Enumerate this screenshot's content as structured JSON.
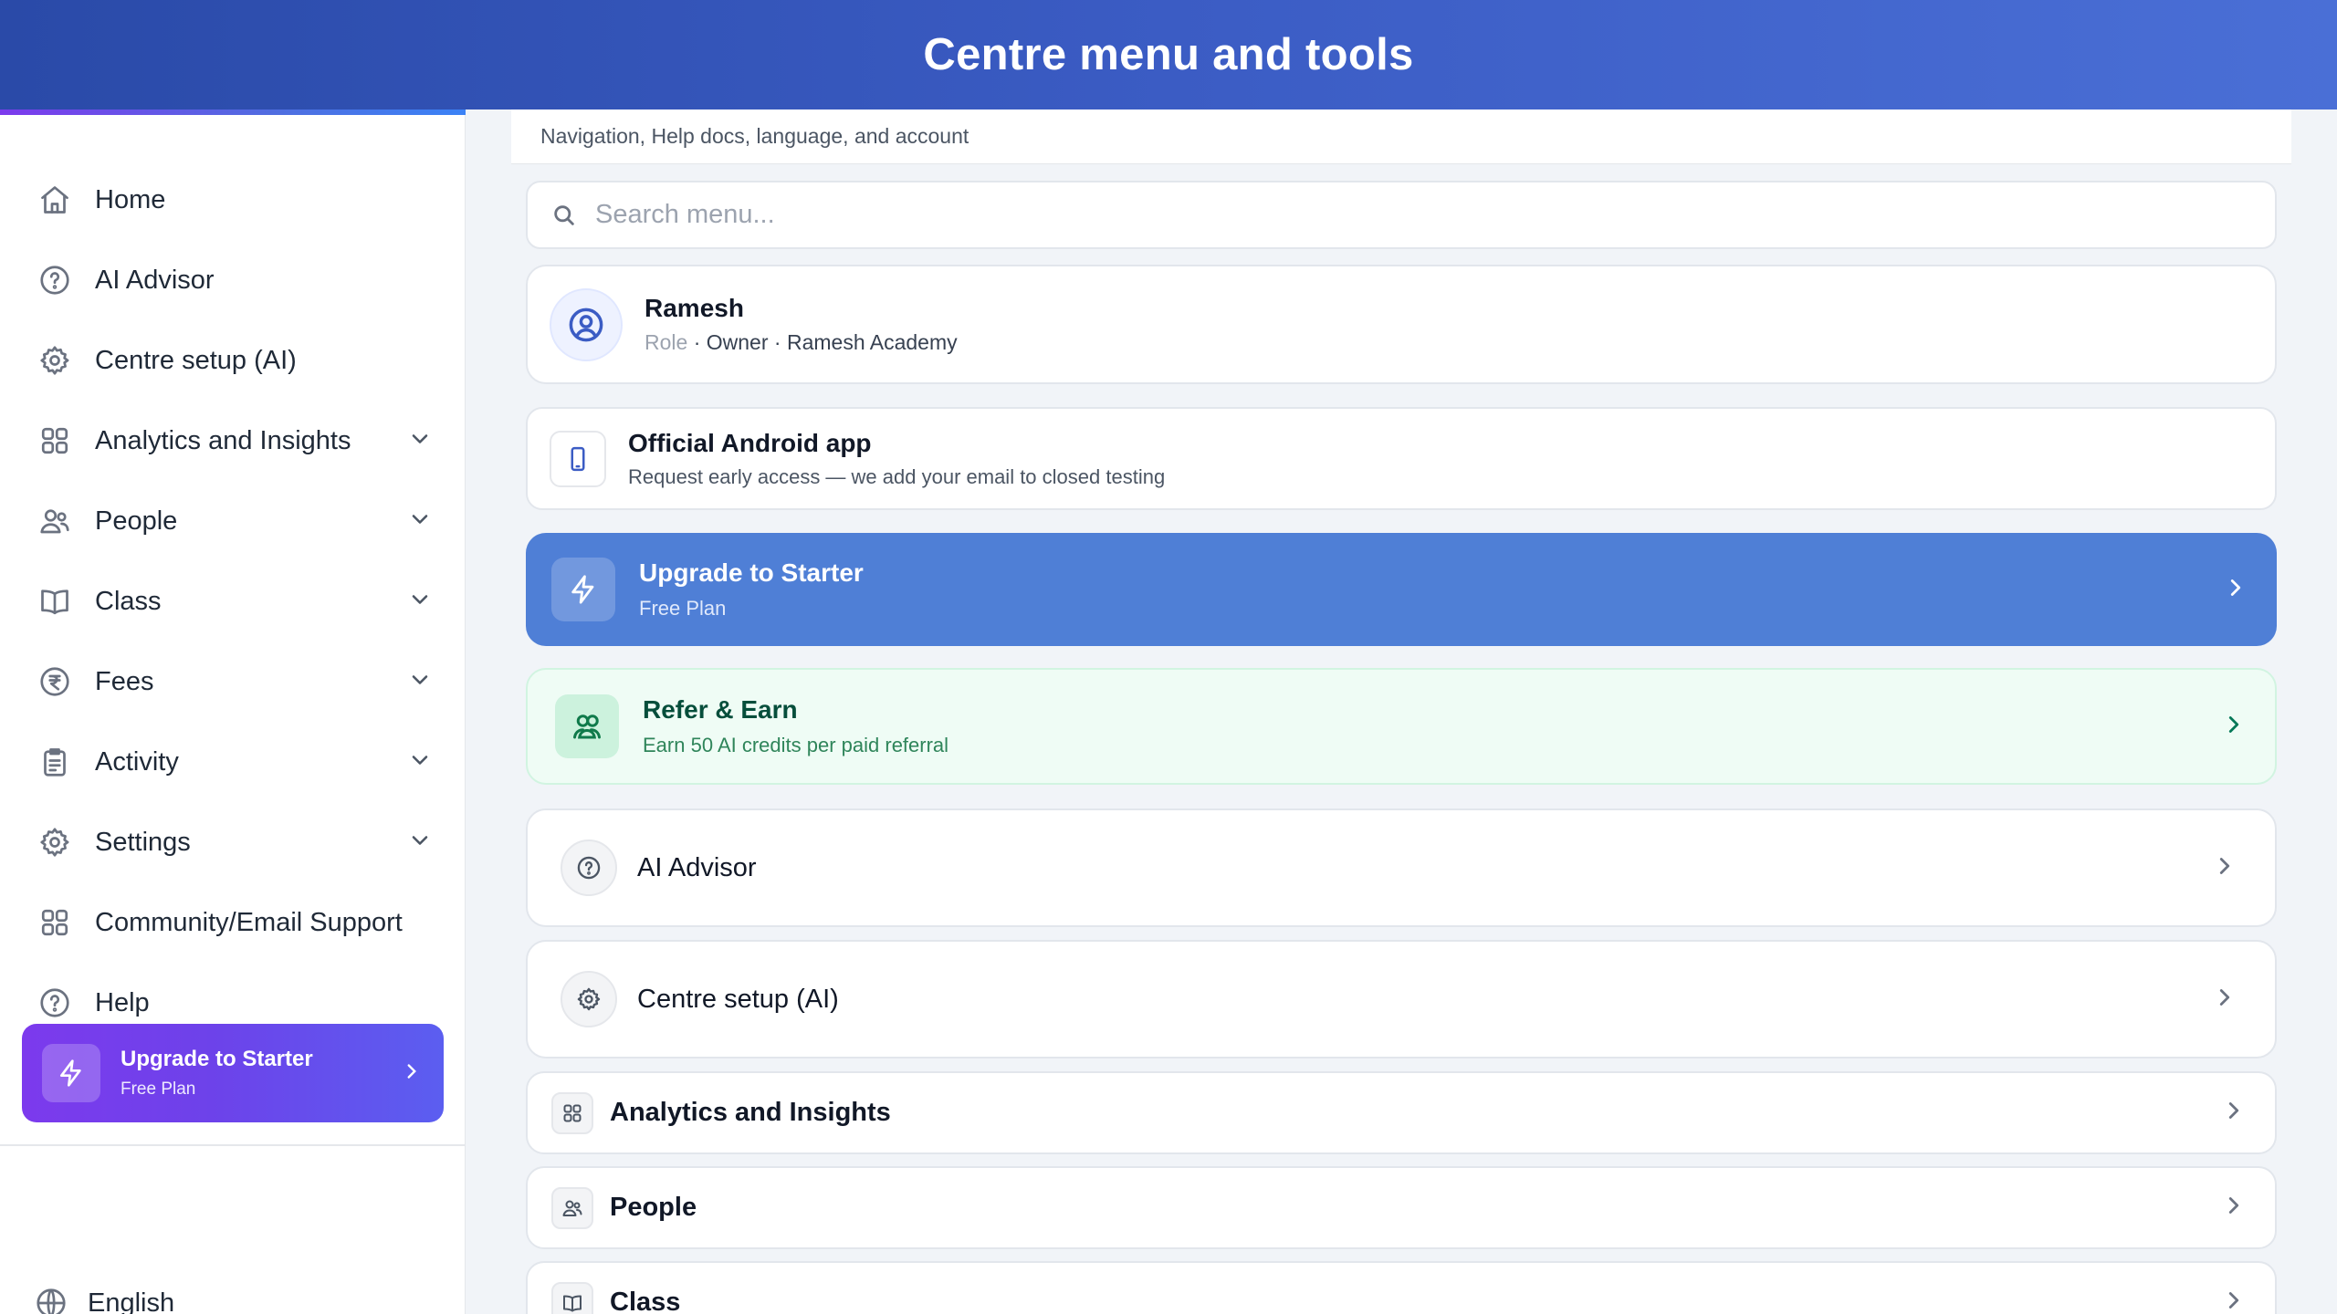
{
  "header": {
    "title": "Centre menu and tools"
  },
  "sidebar": {
    "items": [
      {
        "label": "Home",
        "icon": "home-icon",
        "expandable": false
      },
      {
        "label": "AI Advisor",
        "icon": "help-circle-icon",
        "expandable": false
      },
      {
        "label": "Centre setup (AI)",
        "icon": "gear-icon",
        "expandable": false
      },
      {
        "label": "Analytics and Insights",
        "icon": "grid-icon",
        "expandable": true
      },
      {
        "label": "People",
        "icon": "users-icon",
        "expandable": true
      },
      {
        "label": "Class",
        "icon": "book-icon",
        "expandable": true
      },
      {
        "label": "Fees",
        "icon": "rupee-icon",
        "expandable": true
      },
      {
        "label": "Activity",
        "icon": "clipboard-icon",
        "expandable": true
      },
      {
        "label": "Settings",
        "icon": "gear-icon",
        "expandable": true
      },
      {
        "label": "Community/Email Support",
        "icon": "grid-icon",
        "expandable": false
      },
      {
        "label": "Help",
        "icon": "help-circle-icon",
        "expandable": false
      }
    ],
    "upgrade": {
      "title": "Upgrade to Starter",
      "subtitle": "Free Plan"
    },
    "language": "English"
  },
  "main": {
    "subtitle": "Navigation, Help docs, language, and account",
    "search": {
      "placeholder": "Search menu...",
      "value": ""
    },
    "profile": {
      "name": "Ramesh",
      "role_label": "Role",
      "role": "Owner",
      "centre": "Ramesh Academy"
    },
    "android": {
      "title": "Official Android app",
      "subtitle": "Request early access — we add your email to closed testing"
    },
    "upgrade": {
      "title": "Upgrade to Starter",
      "subtitle": "Free Plan"
    },
    "refer": {
      "title": "Refer & Earn",
      "subtitle": "Earn 50 AI credits per paid referral"
    },
    "menu": [
      {
        "label": "AI Advisor",
        "icon": "help-circle-icon"
      },
      {
        "label": "Centre setup (AI)",
        "icon": "gear-icon"
      },
      {
        "label": "Analytics and Insights",
        "icon": "grid-icon"
      },
      {
        "label": "People",
        "icon": "users-icon"
      },
      {
        "label": "Class",
        "icon": "book-icon"
      }
    ]
  },
  "colors": {
    "header_gradient_start": "#2a4aa8",
    "header_gradient_end": "#4a6fd6",
    "upgrade_card": "#4f7fd6",
    "sidebar_upgrade_start": "#7c3aed",
    "sidebar_upgrade_end": "#5b5ef0",
    "refer_bg": "#effcf5",
    "refer_text": "#064e3b"
  }
}
